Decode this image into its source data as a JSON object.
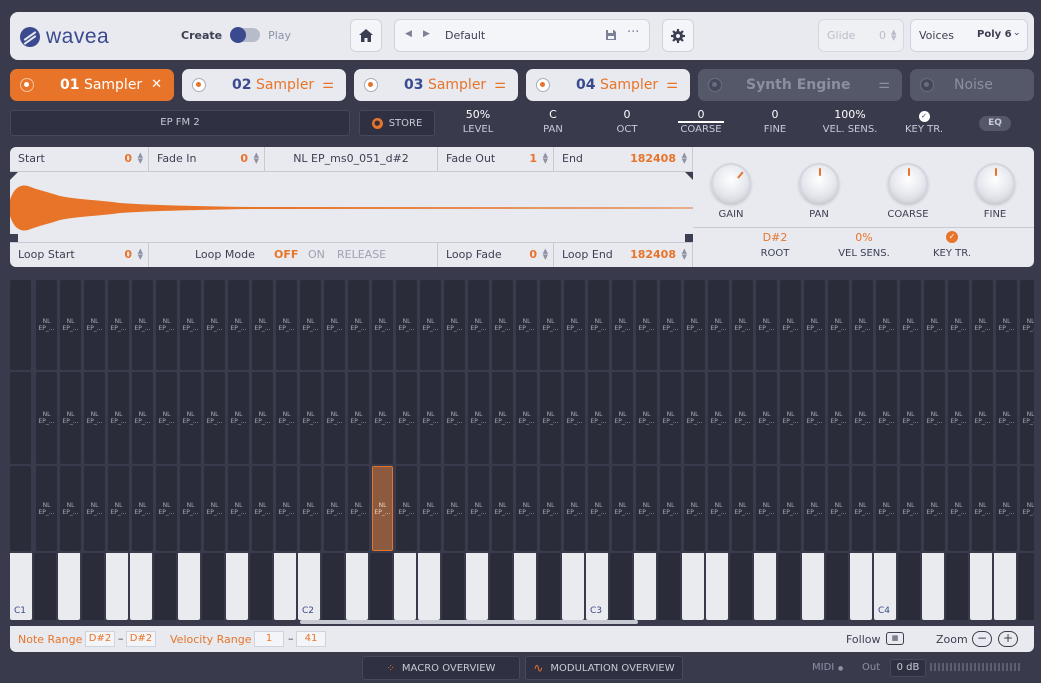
{
  "header": {
    "logo_text": "wavea",
    "create_label": "Create",
    "play_label": "Play",
    "preset_name": "Default",
    "glide_label": "Glide",
    "glide_value": "0",
    "voices_label": "Voices",
    "voices_value": "Poly 6"
  },
  "engines": [
    {
      "num": "01",
      "name": "Sampler",
      "active": true
    },
    {
      "num": "02",
      "name": "Sampler"
    },
    {
      "num": "03",
      "name": "Sampler"
    },
    {
      "num": "04",
      "name": "Sampler"
    },
    {
      "num": "",
      "name": "Synth Engine"
    },
    {
      "num": "",
      "name": "Noise"
    }
  ],
  "params": {
    "sample_name": "EP FM 2",
    "store_label": "STORE",
    "level": {
      "value": "50%",
      "label": "LEVEL"
    },
    "pan": {
      "value": "C",
      "label": "PAN"
    },
    "oct": {
      "value": "0",
      "label": "OCT"
    },
    "coarse": {
      "value": "0",
      "label": "COARSE"
    },
    "fine": {
      "value": "0",
      "label": "FINE"
    },
    "vel_sens": {
      "value": "100%",
      "label": "VEL. SENS."
    },
    "key_tr": {
      "label": "KEY TR."
    },
    "eq_label": "EQ"
  },
  "sample": {
    "start_label": "Start",
    "start_value": "0",
    "fade_in_label": "Fade In",
    "fade_in_value": "0",
    "sample_file": "NL EP_ms0_051_d#2",
    "fade_out_label": "Fade Out",
    "fade_out_value": "1",
    "end_label": "End",
    "end_value": "182408",
    "loop_start_label": "Loop Start",
    "loop_start_value": "0",
    "loop_mode_label": "Loop Mode",
    "loop_mode_off": "OFF",
    "loop_mode_on": "ON",
    "loop_mode_release": "RELEASE",
    "loop_fade_label": "Loop Fade",
    "loop_fade_value": "0",
    "loop_end_label": "Loop End",
    "loop_end_value": "182408"
  },
  "knobs": [
    {
      "label": "GAIN"
    },
    {
      "label": "PAN"
    },
    {
      "label": "COARSE"
    },
    {
      "label": "FINE"
    }
  ],
  "zone": {
    "root_value": "D#2",
    "root_label": "ROOT",
    "vel_value": "0%",
    "vel_label": "VEL SENS.",
    "keytr_label": "KEY TR."
  },
  "grid": {
    "cell_line1": "NL",
    "cell_line2": "EP_...",
    "octave_labels": [
      "C1",
      "C2",
      "C3",
      "C4"
    ]
  },
  "footer": {
    "note_range_label": "Note Range",
    "note_low": "D#2",
    "note_high": "D#2",
    "velocity_range_label": "Velocity Range",
    "vel_low": "1",
    "vel_high": "41",
    "dash": "–",
    "follow_label": "Follow",
    "zoom_label": "Zoom",
    "zoom_minus": "−",
    "zoom_plus": "+"
  },
  "bottom": {
    "macro_label": "MACRO OVERVIEW",
    "modulation_label": "MODULATION OVERVIEW",
    "midi_label": "MIDI",
    "out_label": "Out",
    "out_value": "0 dB"
  },
  "colors": {
    "accent": "#e8742a",
    "brand": "#3b4a8f",
    "bg": "#393b4d"
  }
}
